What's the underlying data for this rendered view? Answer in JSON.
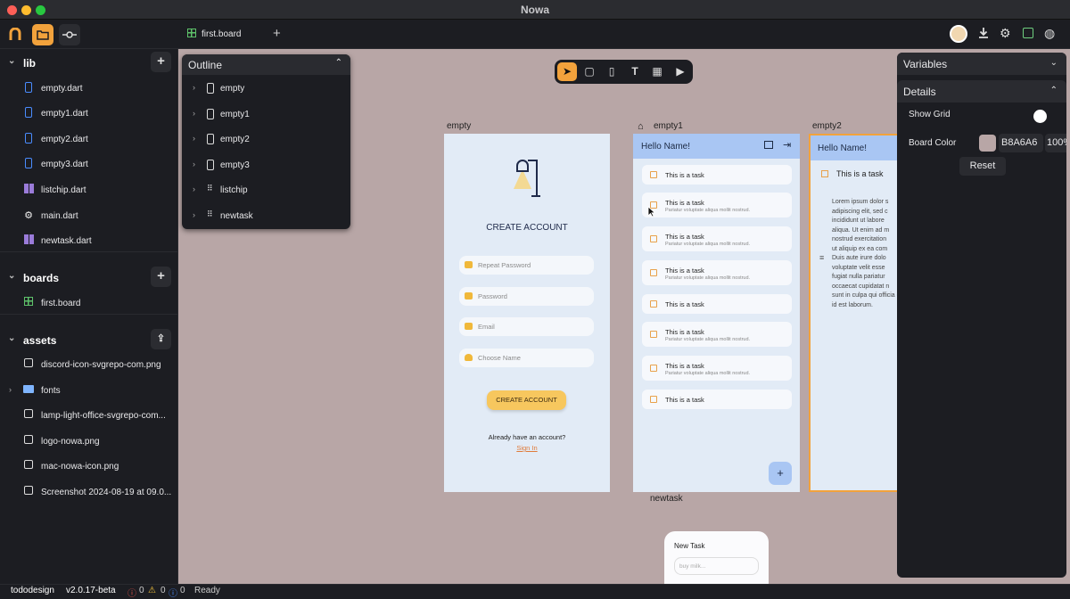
{
  "window": {
    "title": "Nowa"
  },
  "toolbar": {
    "tab_label": "first.board",
    "add_tab": "+"
  },
  "sidebar": {
    "lib": {
      "label": "lib",
      "items": [
        {
          "label": "empty.dart"
        },
        {
          "label": "empty1.dart"
        },
        {
          "label": "empty2.dart"
        },
        {
          "label": "empty3.dart"
        },
        {
          "label": "listchip.dart"
        },
        {
          "label": "main.dart"
        },
        {
          "label": "newtask.dart"
        }
      ]
    },
    "boards": {
      "label": "boards",
      "items": [
        {
          "label": "first.board"
        }
      ]
    },
    "assets": {
      "label": "assets",
      "items": [
        {
          "label": "discord-icon-svgrepo-com.png"
        },
        {
          "label": "fonts"
        },
        {
          "label": "lamp-light-office-svgrepo-com..."
        },
        {
          "label": "logo-nowa.png"
        },
        {
          "label": "mac-nowa-icon.png"
        },
        {
          "label": "Screenshot 2024-08-19 at 09.0..."
        }
      ]
    }
  },
  "outline": {
    "title": "Outline",
    "items": [
      {
        "label": "empty"
      },
      {
        "label": "empty1"
      },
      {
        "label": "empty2"
      },
      {
        "label": "empty3"
      },
      {
        "label": "listchip"
      },
      {
        "label": "newtask"
      }
    ]
  },
  "canvas": {
    "board_color": "#b8a6a6",
    "frames": {
      "empty": {
        "label": "empty",
        "heading": "CREATE ACCOUNT",
        "fields": [
          "Repeat Password",
          "Password",
          "Email",
          "Choose Name"
        ],
        "button": "CREATE ACCOUNT",
        "footer": "Already have an account?",
        "link": "Sign In"
      },
      "empty1": {
        "label": "empty1",
        "appbar_title": "Hello Name!",
        "tasks": [
          {
            "title": "This is a task",
            "subtitle": ""
          },
          {
            "title": "This is a task",
            "subtitle": "Pariatur voluptate aliqua mollit nostrud."
          },
          {
            "title": "This is a task",
            "subtitle": "Pariatur voluptate aliqua mollit nostrud."
          },
          {
            "title": "This is a task",
            "subtitle": "Pariatur voluptate aliqua mollit nostrud."
          },
          {
            "title": "This is a task",
            "subtitle": ""
          },
          {
            "title": "This is a task",
            "subtitle": "Pariatur voluptate aliqua mollit nostrud."
          },
          {
            "title": "This is a task",
            "subtitle": "Pariatur voluptate aliqua mollit nostrud."
          },
          {
            "title": "This is a task",
            "subtitle": ""
          }
        ],
        "fab": "+"
      },
      "empty2": {
        "label": "empty2",
        "appbar_title": "Hello Name!",
        "task_title": "This is a task",
        "body_lines": [
          "Lorem ipsum dolor s",
          "adipiscing elit, sed c",
          "incididunt ut labore",
          "aliqua. Ut enim ad m",
          "nostrud exercitation",
          "ut aliquip ex ea com",
          "Duis aute irure dolo",
          "voluptate velit esse",
          "fugiat nulla pariatur",
          "occaecat cupidatat n",
          "sunt in culpa qui officia d",
          "id est laborum."
        ]
      },
      "newtask": {
        "label": "newtask",
        "title": "New Task",
        "placeholder": "buy milk..."
      }
    }
  },
  "right_panel": {
    "variables": "Variables",
    "details": "Details",
    "show_grid": {
      "label": "Show Grid",
      "on": false
    },
    "board_color": {
      "label": "Board Color",
      "hex": "B8A6A6",
      "opacity": "100%",
      "swatch": "#b8a6a6"
    },
    "reset": "Reset"
  },
  "status": {
    "project": "tododesign",
    "version": "v2.0.17-beta",
    "errors": "0",
    "warnings": "0",
    "infos": "0",
    "state": "Ready"
  },
  "colors": {
    "accent": "#f2a23c",
    "appbar": "#a9c6f3",
    "phone_bg": "#e2ebf6"
  }
}
